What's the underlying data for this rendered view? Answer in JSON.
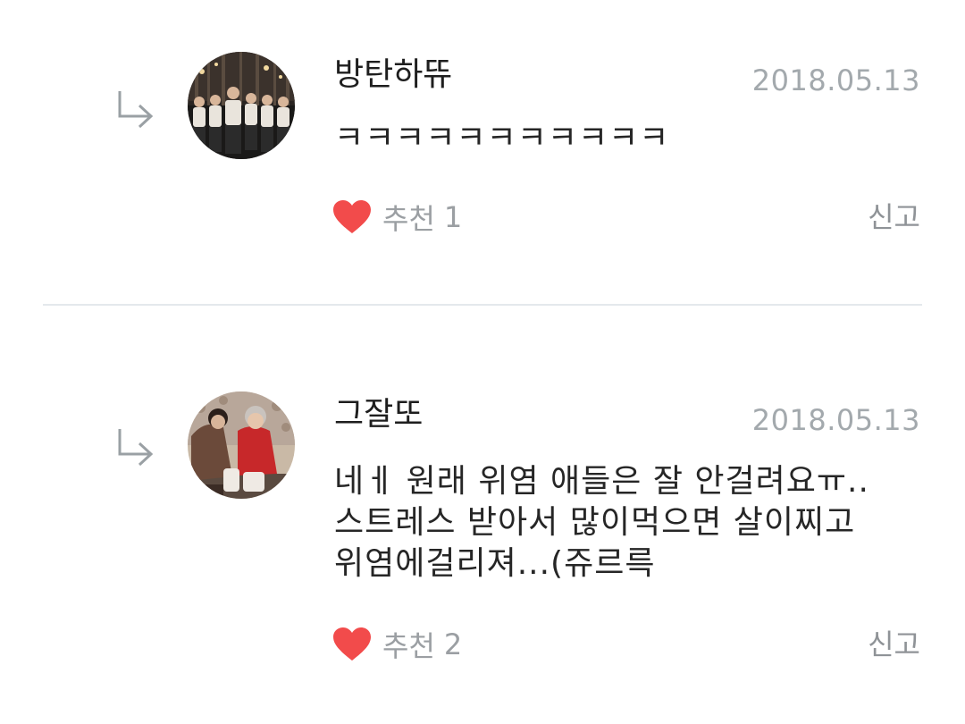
{
  "comments": [
    {
      "author": "방탄하뜌",
      "date": "2018.05.13",
      "lines": [
        "ㅋㅋㅋㅋㅋㅋㅋㅋㅋㅋㅋ"
      ],
      "like_label": "추천",
      "like_count": "1",
      "report_label": "신고",
      "avatar": "group-photo"
    },
    {
      "author": "그잘또",
      "date": "2018.05.13",
      "lines": [
        "네ㅔ 원래 위염 애들은 잘 안걸려요ㅠ..",
        "스트레스 받아서 많이먹으면 살이찌고",
        "위염에걸리져...(쥬르륵"
      ],
      "like_label": "추천",
      "like_count": "2",
      "report_label": "신고",
      "avatar": "duo-photo"
    }
  ],
  "icons": {
    "reply": "reply-arrow-icon",
    "like": "heart-icon"
  },
  "colors": {
    "heart": "#f24b4b",
    "date": "#a3a9ad",
    "divider": "#e4e9ec"
  }
}
